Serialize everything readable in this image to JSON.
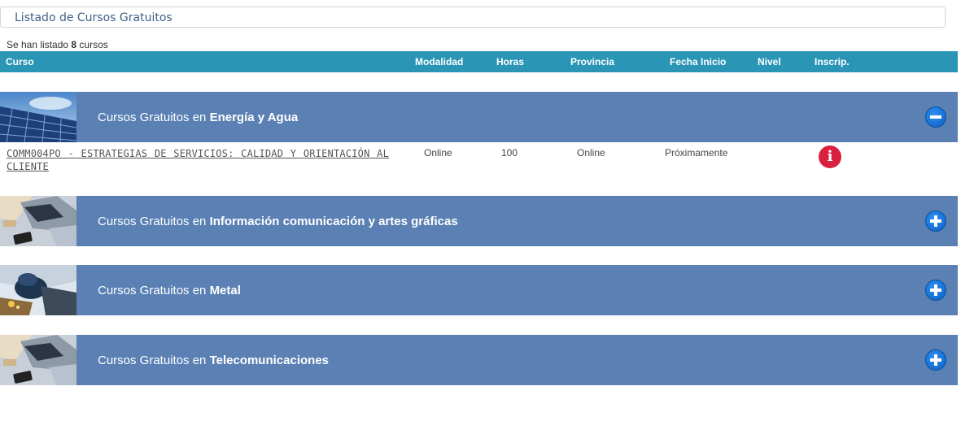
{
  "page": {
    "title": "Listado de Cursos Gratuitos",
    "count_prefix": "Se han listado ",
    "count_value": "8",
    "count_suffix": " cursos"
  },
  "table_header": {
    "curso": "Curso",
    "modalidad": "Modalidad",
    "horas": "Horas",
    "provincia": "Provincia",
    "fecha_inicio": "Fecha Inicio",
    "nivel": "Nivel",
    "inscrip": "Inscrip."
  },
  "categories": [
    {
      "prefix": "Cursos Gratuitos en ",
      "name": "Energía y Agua",
      "expanded": true,
      "toggle_icon": "minus-icon"
    },
    {
      "prefix": "Cursos Gratuitos en ",
      "name": "Información comunicación y artes gráficas",
      "expanded": false,
      "toggle_icon": "plus-icon"
    },
    {
      "prefix": "Cursos Gratuitos en ",
      "name": "Metal",
      "expanded": false,
      "toggle_icon": "plus-icon"
    },
    {
      "prefix": "Cursos Gratuitos en ",
      "name": "Telecomunicaciones",
      "expanded": false,
      "toggle_icon": "plus-icon"
    }
  ],
  "courses": [
    {
      "title": "COMM004PO - ESTRATEGIAS DE SERVICIOS: CALIDAD Y ORIENTACIÓN AL CLIENTE",
      "modalidad": "Online",
      "horas": "100",
      "provincia": "Online",
      "fecha_inicio": "Próximamente",
      "nivel": "",
      "inscrip_icon": "info-icon",
      "info_glyph": "i"
    }
  ],
  "colors": {
    "header_bg": "#2a95b5",
    "category_bg": "#5a80b4",
    "toggle_blue": "#0c5fc4",
    "info_red": "#d9213f"
  }
}
